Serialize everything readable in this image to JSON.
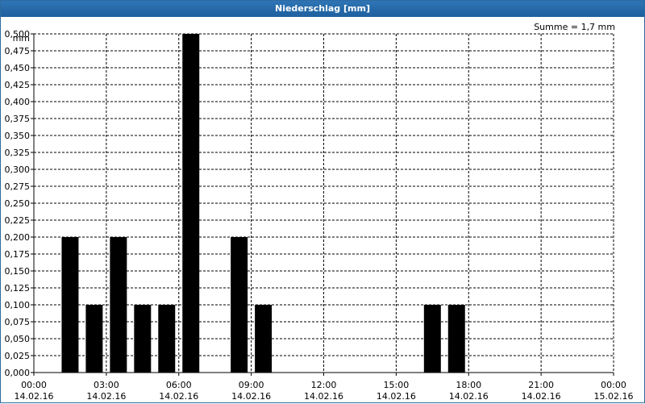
{
  "window": {
    "title": "Niederschlag [mm]"
  },
  "chart_data": {
    "type": "bar",
    "title": "Niederschlag [mm]",
    "ylabel": "mm",
    "annotation": "Summe = 1,7 mm",
    "ylim": [
      0,
      0.5
    ],
    "y_ticks": [
      "0,000",
      "0,025",
      "0,050",
      "0,075",
      "0,100",
      "0,125",
      "0,150",
      "0,175",
      "0,200",
      "0,225",
      "0,250",
      "0,275",
      "0,300",
      "0,325",
      "0,350",
      "0,375",
      "0,400",
      "0,425",
      "0,450",
      "0,475",
      "0,500"
    ],
    "x_ticks": [
      {
        "time": "00:00",
        "date": "14.02.16"
      },
      {
        "time": "03:00",
        "date": "14.02.16"
      },
      {
        "time": "06:00",
        "date": "14.02.16"
      },
      {
        "time": "09:00",
        "date": "14.02.16"
      },
      {
        "time": "12:00",
        "date": "14.02.16"
      },
      {
        "time": "15:00",
        "date": "14.02.16"
      },
      {
        "time": "18:00",
        "date": "14.02.16"
      },
      {
        "time": "21:00",
        "date": "14.02.16"
      },
      {
        "time": "00:00",
        "date": "15.02.16"
      }
    ],
    "x_range_hours": [
      0,
      24
    ],
    "grid": true,
    "bar_color": "#000000",
    "series": [
      {
        "values": [
          {
            "hour": 1.5,
            "value": 0.2
          },
          {
            "hour": 2.5,
            "value": 0.1
          },
          {
            "hour": 3.5,
            "value": 0.2
          },
          {
            "hour": 4.5,
            "value": 0.1
          },
          {
            "hour": 5.5,
            "value": 0.1
          },
          {
            "hour": 6.5,
            "value": 0.5
          },
          {
            "hour": 8.5,
            "value": 0.2
          },
          {
            "hour": 9.5,
            "value": 0.1
          },
          {
            "hour": 16.5,
            "value": 0.1
          },
          {
            "hour": 17.5,
            "value": 0.1
          }
        ]
      }
    ]
  }
}
